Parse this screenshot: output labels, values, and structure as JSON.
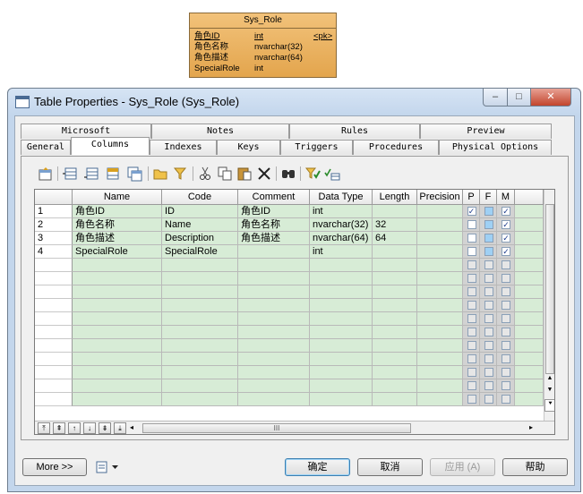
{
  "entity": {
    "title": "Sys_Role",
    "rows": [
      {
        "name": "角色ID",
        "type": "int",
        "key": "<pk>"
      },
      {
        "name": "角色名称",
        "type": "nvarchar(32)",
        "key": ""
      },
      {
        "name": "角色描述",
        "type": "nvarchar(64)",
        "key": ""
      },
      {
        "name": "SpecialRole",
        "type": "int",
        "key": ""
      }
    ]
  },
  "window": {
    "title": "Table Properties - Sys_Role (Sys_Role)",
    "minimize": "‒",
    "maximize": "□",
    "close": "✕"
  },
  "tabs_top": [
    "Microsoft",
    "Notes",
    "Rules",
    "Preview"
  ],
  "tabs_bottom": [
    "General",
    "Columns",
    "Indexes",
    "Keys",
    "Triggers",
    "Procedures",
    "Physical Options"
  ],
  "active_tab": "Columns",
  "toolbar_icons": [
    "properties-icon",
    "insert-row-icon",
    "add-row-icon",
    "add-columns-icon",
    "copy-columns-icon",
    "folder-icon",
    "filter-icon",
    "cut-icon",
    "copy-icon",
    "paste-icon",
    "delete-icon",
    "find-icon",
    "customize-columns-icon",
    "customize-filter-icon"
  ],
  "grid": {
    "headers": {
      "name": "Name",
      "code": "Code",
      "comment": "Comment",
      "datatype": "Data Type",
      "length": "Length",
      "precision": "Precision",
      "p": "P",
      "f": "F",
      "m": "M"
    },
    "rows": [
      {
        "num": "1",
        "name": "角色ID",
        "code": "ID",
        "comment": "角色ID",
        "datatype": "int",
        "length": "",
        "precision": "",
        "p": true,
        "f": false,
        "m": true
      },
      {
        "num": "2",
        "name": "角色名称",
        "code": "Name",
        "comment": "角色名称",
        "datatype": "nvarchar(32)",
        "length": "32",
        "precision": "",
        "p": false,
        "f": false,
        "m": true
      },
      {
        "num": "3",
        "name": "角色描述",
        "code": "Description",
        "comment": "角色描述",
        "datatype": "nvarchar(64)",
        "length": "64",
        "precision": "",
        "p": false,
        "f": false,
        "m": true
      },
      {
        "num": "4",
        "name": "SpecialRole",
        "code": "SpecialRole",
        "comment": "",
        "datatype": "int",
        "length": "",
        "precision": "",
        "p": false,
        "f": false,
        "m": true
      }
    ],
    "empty_rows": 11,
    "hscroll_grip": "III"
  },
  "buttons": {
    "more": "More >>",
    "ok": "确定",
    "cancel": "取消",
    "apply": "应用 (A)",
    "help": "帮助"
  }
}
